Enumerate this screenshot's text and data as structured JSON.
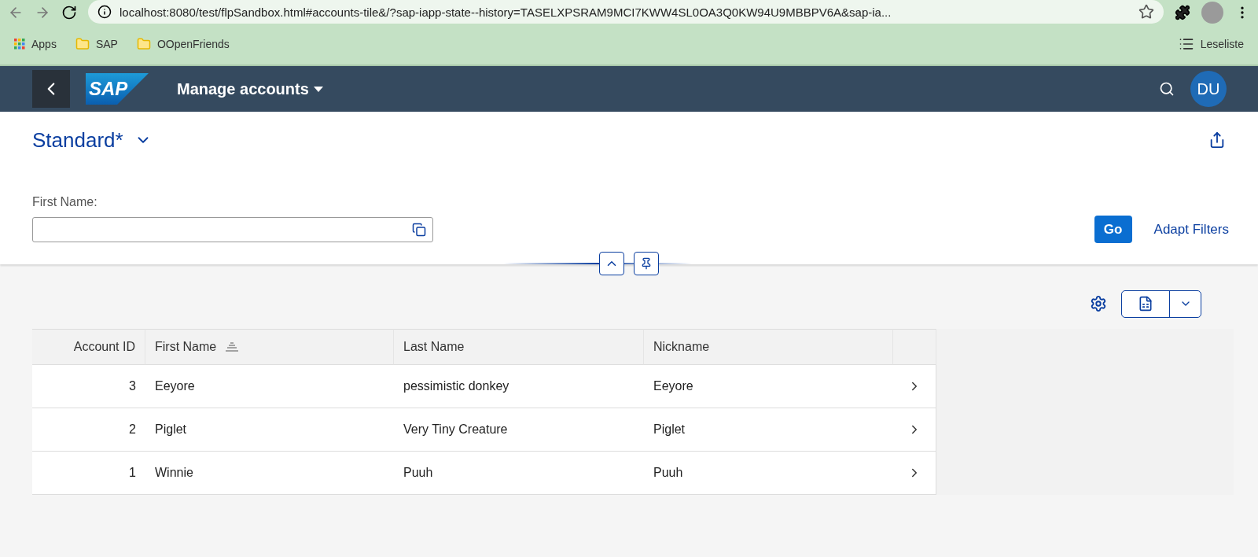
{
  "browser": {
    "url": "localhost:8080/test/flpSandbox.html#accounts-tile&/?sap-iapp-state--history=TASELXPSRAM9MCI7KWW4SL0OA3Q0KW94U9MBBPV6A&sap-ia...",
    "bookmarks": [
      {
        "kind": "apps",
        "label": "Apps"
      },
      {
        "kind": "folder",
        "label": "SAP"
      },
      {
        "kind": "folder",
        "label": "OOpenFriends"
      }
    ],
    "reading_list": "Leseliste"
  },
  "shell": {
    "logo": "SAP",
    "title": "Manage accounts",
    "avatar": "DU"
  },
  "variant": {
    "name": "Standard*"
  },
  "filter": {
    "label": "First Name:",
    "go": "Go",
    "adapt": "Adapt Filters"
  },
  "table": {
    "columns": [
      {
        "label": "Account ID",
        "sorted": false
      },
      {
        "label": "First Name",
        "sorted": true
      },
      {
        "label": "Last Name",
        "sorted": false
      },
      {
        "label": "Nickname",
        "sorted": false
      }
    ],
    "rows": [
      [
        "3",
        "Eeyore",
        "pessimistic donkey",
        "Eeyore"
      ],
      [
        "2",
        "Piglet",
        "Very Tiny Creature",
        "Piglet"
      ],
      [
        "1",
        "Winnie",
        "Puuh",
        "Puuh"
      ]
    ]
  }
}
